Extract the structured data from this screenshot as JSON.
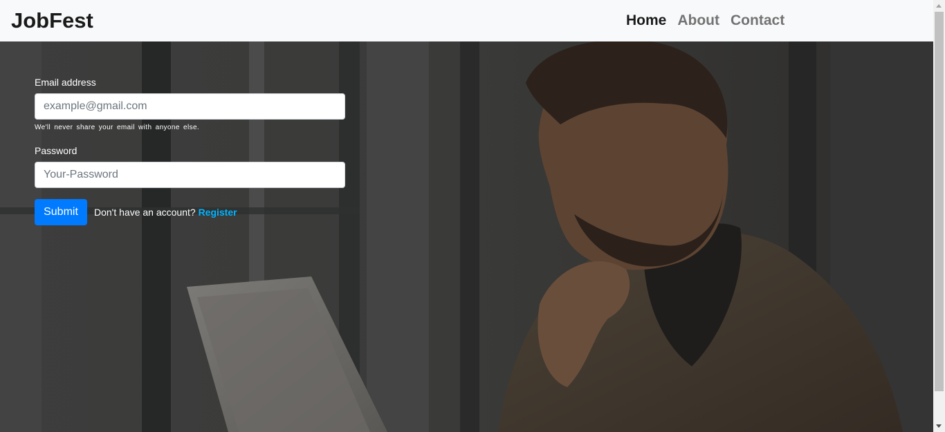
{
  "navbar": {
    "brand": "JobFest",
    "links": [
      {
        "label": "Home",
        "active": true
      },
      {
        "label": "About",
        "active": false
      },
      {
        "label": "Contact",
        "active": false
      }
    ]
  },
  "form": {
    "email_label": "Email address",
    "email_placeholder": "example@gmail.com",
    "email_help": "We'll never share your email with anyone else.",
    "password_label": "Password",
    "password_placeholder": "Your-Password",
    "submit_label": "Submit",
    "register_prompt": "Don't have an account?",
    "register_link": "Register"
  },
  "colors": {
    "primary": "#007bff",
    "link": "#00b4ff",
    "navbar_bg": "#f8f9fa"
  }
}
